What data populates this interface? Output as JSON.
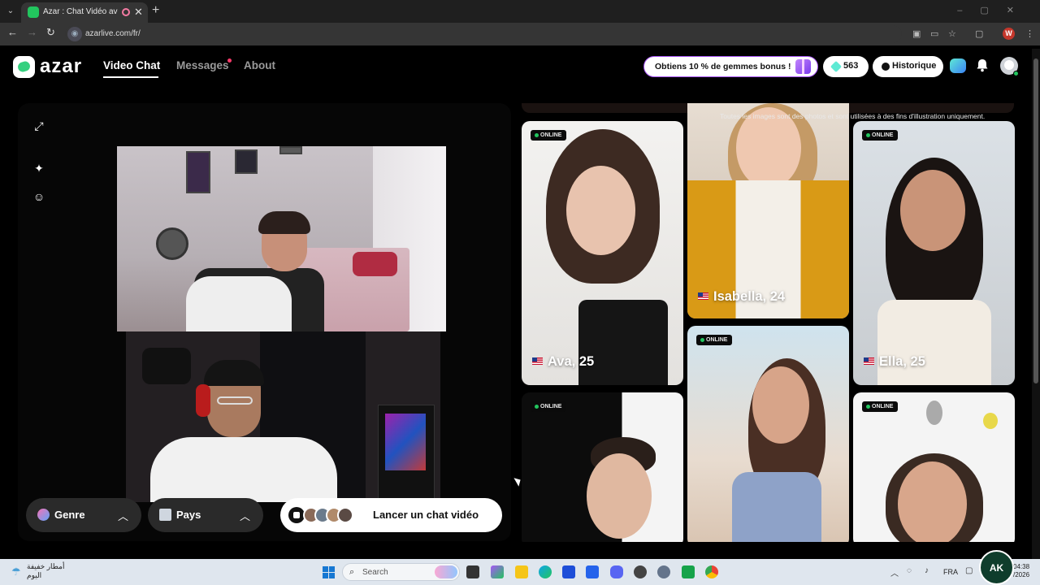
{
  "browser": {
    "tab_title": "Azar : Chat Vidéo avec de n",
    "url": "azarlive.com/fr/",
    "profile_initial": "W"
  },
  "header": {
    "logo": "azar",
    "nav": [
      {
        "label": "Video Chat",
        "active": true
      },
      {
        "label": "Messages",
        "active": false,
        "has_dot": true
      },
      {
        "label": "About",
        "active": false
      }
    ],
    "promo": "Obtiens 10 % de gemmes bonus !",
    "gems_count": "563",
    "history_label": "Historique"
  },
  "video_panel": {
    "filters": [
      {
        "label": "Genre",
        "icon": "gender-icon"
      },
      {
        "label": "Pays",
        "icon": "flag-icon"
      }
    ],
    "start_button": "Lancer un chat vidéo",
    "side_tools": [
      "expand-icon",
      "magic-wand-icon",
      "sticker-icon"
    ]
  },
  "grid": {
    "disclaimer": "Toutes les images sont des photos et sont utilisées à des fins d'illustration uniquement.",
    "badge": "ONLINE",
    "profiles": [
      {
        "name": "Ava, 25",
        "country": "US",
        "online": true
      },
      {
        "name": "Isabella, 24",
        "country": "US",
        "online": false
      },
      {
        "name": "Ella, 25",
        "country": "US",
        "online": true
      },
      {
        "name": "",
        "online": true
      },
      {
        "name": "",
        "online": true
      },
      {
        "name": "",
        "online": true
      }
    ]
  },
  "taskbar": {
    "weather_line1": "أمطار خفيفة",
    "weather_line2": "اليوم",
    "search_placeholder": "Search",
    "language": "FRA",
    "time": "04:38",
    "date": "/2026"
  },
  "colors": {
    "accent_green": "#35d07f",
    "online_green": "#22c55e",
    "promo_border": "#a855f7"
  }
}
